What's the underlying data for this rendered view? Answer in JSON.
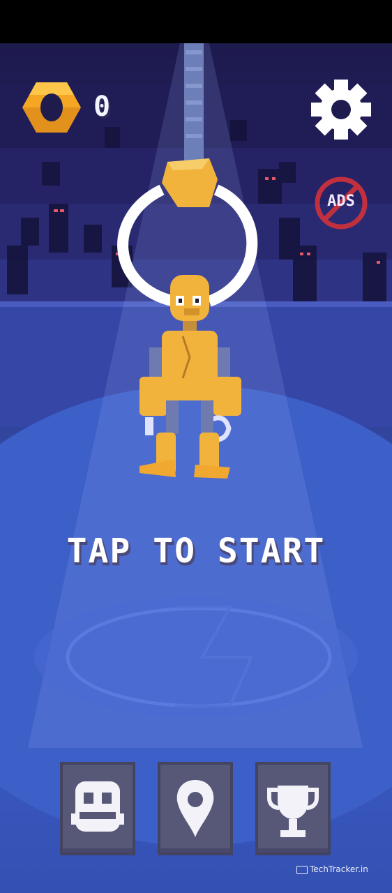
{
  "hud": {
    "coin_icon": "hex-nut-icon",
    "coin_count": "0",
    "settings_icon": "gear-icon",
    "no_ads_label": "ADS"
  },
  "prompt": {
    "tap_to_start": "TAP TO START"
  },
  "bottom_menu": [
    {
      "icon": "robot-face-icon"
    },
    {
      "icon": "map-pin-icon"
    },
    {
      "icon": "trophy-icon"
    }
  ],
  "watermark": {
    "text": "TechTracker.in"
  },
  "colors": {
    "coin_orange": "#f5a623",
    "robot_yellow": "#f2b33d",
    "floor_blue": "#3b5cc4",
    "button_gray": "#575878"
  }
}
